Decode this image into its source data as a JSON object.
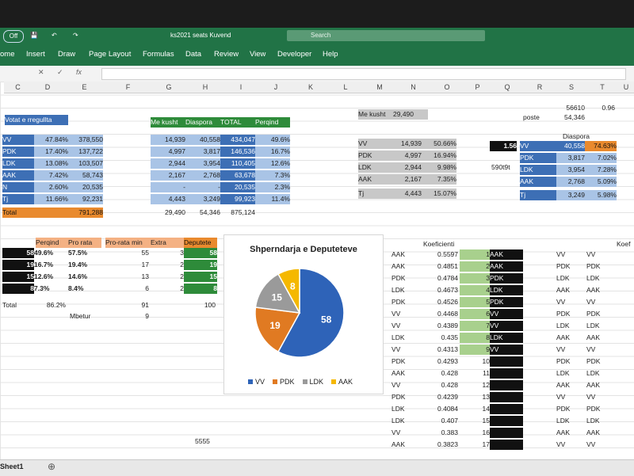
{
  "app": {
    "toggle": "Off",
    "window_title": "ks2021 seats Kuvend",
    "search_placeholder": "Search",
    "tabs": [
      "ome",
      "Insert",
      "Draw",
      "Page Layout",
      "Formulas",
      "Data",
      "Review",
      "View",
      "Developer",
      "Help"
    ],
    "fx": "fx",
    "sheet_tab": "Sheet1"
  },
  "columns": [
    "C",
    "D",
    "E",
    "F",
    "G",
    "H",
    "I",
    "J",
    "K",
    "L",
    "M",
    "N",
    "O",
    "P",
    "Q",
    "R",
    "S",
    "T",
    "U"
  ],
  "block1": {
    "header": "Votat e rregullta",
    "rows": [
      [
        "VV",
        "47.84%",
        "378,550"
      ],
      [
        "PDK",
        "17.40%",
        "137,722"
      ],
      [
        "LDK",
        "13.08%",
        "103,507"
      ],
      [
        "AAK",
        "7.42%",
        "58,743"
      ],
      [
        "N",
        "2.60%",
        "20,535"
      ],
      [
        "Tj",
        "11.66%",
        "92,231"
      ]
    ],
    "total_label": "Total",
    "total_value": "791,288"
  },
  "block2": {
    "headers": [
      "Me kusht",
      "Diaspora",
      "TOTAL",
      "Perqind"
    ],
    "rows": [
      [
        "14,939",
        "40,558",
        "434,047",
        "49.6%"
      ],
      [
        "4,997",
        "3,817",
        "146,536",
        "16.7%"
      ],
      [
        "2,944",
        "3,954",
        "110,405",
        "12.6%"
      ],
      [
        "2,167",
        "2,768",
        "63,678",
        "7.3%"
      ],
      [
        "-",
        "-",
        "20,535",
        "2.3%"
      ],
      [
        "4,443",
        "3,249",
        "99,923",
        "11.4%"
      ]
    ],
    "totals": [
      "29,490",
      "54,346",
      "875,124"
    ]
  },
  "block3": {
    "label": "Me kusht",
    "value": "29,490",
    "rows": [
      [
        "VV",
        "14,939",
        "50.66%"
      ],
      [
        "PDK",
        "4,997",
        "16.94%"
      ],
      [
        "LDK",
        "2,944",
        "9.98%"
      ],
      [
        "AAK",
        "2,167",
        "7.35%"
      ],
      [
        "Tj",
        "4,443",
        "15.07%"
      ]
    ]
  },
  "block4": {
    "top_s": "56610",
    "top_t": "0.96",
    "poste_label": "poste",
    "poste_value": "54,346",
    "title": "Diaspora",
    "ratio": "1.56",
    "side_note": "590t9t",
    "rows": [
      [
        "VV",
        "40,558",
        "74.63%"
      ],
      [
        "PDK",
        "3,817",
        "7.02%"
      ],
      [
        "LDK",
        "3,954",
        "7.28%"
      ],
      [
        "AAK",
        "2,768",
        "5.09%"
      ],
      [
        "Tj",
        "3,249",
        "5.98%"
      ]
    ]
  },
  "block5": {
    "headers": [
      "Perqind",
      "Pro rata",
      "Pro-rata min",
      "Extra",
      "Deputete"
    ],
    "rows": [
      [
        "58",
        "49.6%",
        "57.5%",
        "55",
        "3",
        "58"
      ],
      [
        "19",
        "16.7%",
        "19.4%",
        "17",
        "2",
        "19"
      ],
      [
        "15",
        "12.6%",
        "14.6%",
        "13",
        "2",
        "15"
      ],
      [
        "8",
        "7.3%",
        "8.4%",
        "6",
        "2",
        "8"
      ]
    ],
    "total_label": "Total",
    "total_pct": "86.2%",
    "total_min": "91",
    "total_dep": "100",
    "mbetur_label": "Mbetur",
    "mbetur_value": "9",
    "bottom_value": "5555"
  },
  "coef": {
    "title": "Koeficienti",
    "rows": [
      [
        "AAK",
        "0.5597",
        "1",
        "AAK"
      ],
      [
        "AAK",
        "0.4851",
        "2",
        "AAK"
      ],
      [
        "PDK",
        "0.4784",
        "3",
        "PDK"
      ],
      [
        "LDK",
        "0.4673",
        "4",
        "LDK"
      ],
      [
        "PDK",
        "0.4526",
        "5",
        "PDK"
      ],
      [
        "VV",
        "0.4468",
        "6",
        "VV"
      ],
      [
        "VV",
        "0.4389",
        "7",
        "VV"
      ],
      [
        "LDK",
        "0.435",
        "8",
        "LDK"
      ],
      [
        "VV",
        "0.4313",
        "9",
        "VV"
      ],
      [
        "PDK",
        "0.4293",
        "10",
        ""
      ],
      [
        "AAK",
        "0.428",
        "11",
        ""
      ],
      [
        "VV",
        "0.428",
        "12",
        ""
      ],
      [
        "PDK",
        "0.4239",
        "13",
        ""
      ],
      [
        "LDK",
        "0.4084",
        "14",
        ""
      ],
      [
        "LDK",
        "0.407",
        "15",
        ""
      ],
      [
        "VV",
        "0.383",
        "16",
        ""
      ],
      [
        "AAK",
        "0.3823",
        "17",
        ""
      ]
    ]
  },
  "right_list": {
    "header": "Koef",
    "col1": [
      "VV",
      "PDK",
      "LDK",
      "AAK",
      "VV",
      "PDK",
      "LDK",
      "AAK",
      "VV",
      "PDK",
      "LDK",
      "AAK",
      "VV",
      "PDK",
      "LDK",
      "AAK",
      "VV"
    ],
    "col2": [
      "VV",
      "PDK",
      "LDK",
      "AAK",
      "VV",
      "PDK",
      "LDK",
      "AAK",
      "VV",
      "PDK",
      "LDK",
      "AAK",
      "VV",
      "PDK",
      "LDK",
      "AAK",
      "VV"
    ]
  },
  "chart_data": {
    "type": "pie",
    "title": "Shperndarja e Deputeteve",
    "categories": [
      "VV",
      "PDK",
      "LDK",
      "AAK"
    ],
    "values": [
      58,
      19,
      15,
      8
    ],
    "colors": [
      "#2e63b8",
      "#e07a22",
      "#9a9a9a",
      "#f5b800"
    ],
    "legend_position": "bottom"
  }
}
